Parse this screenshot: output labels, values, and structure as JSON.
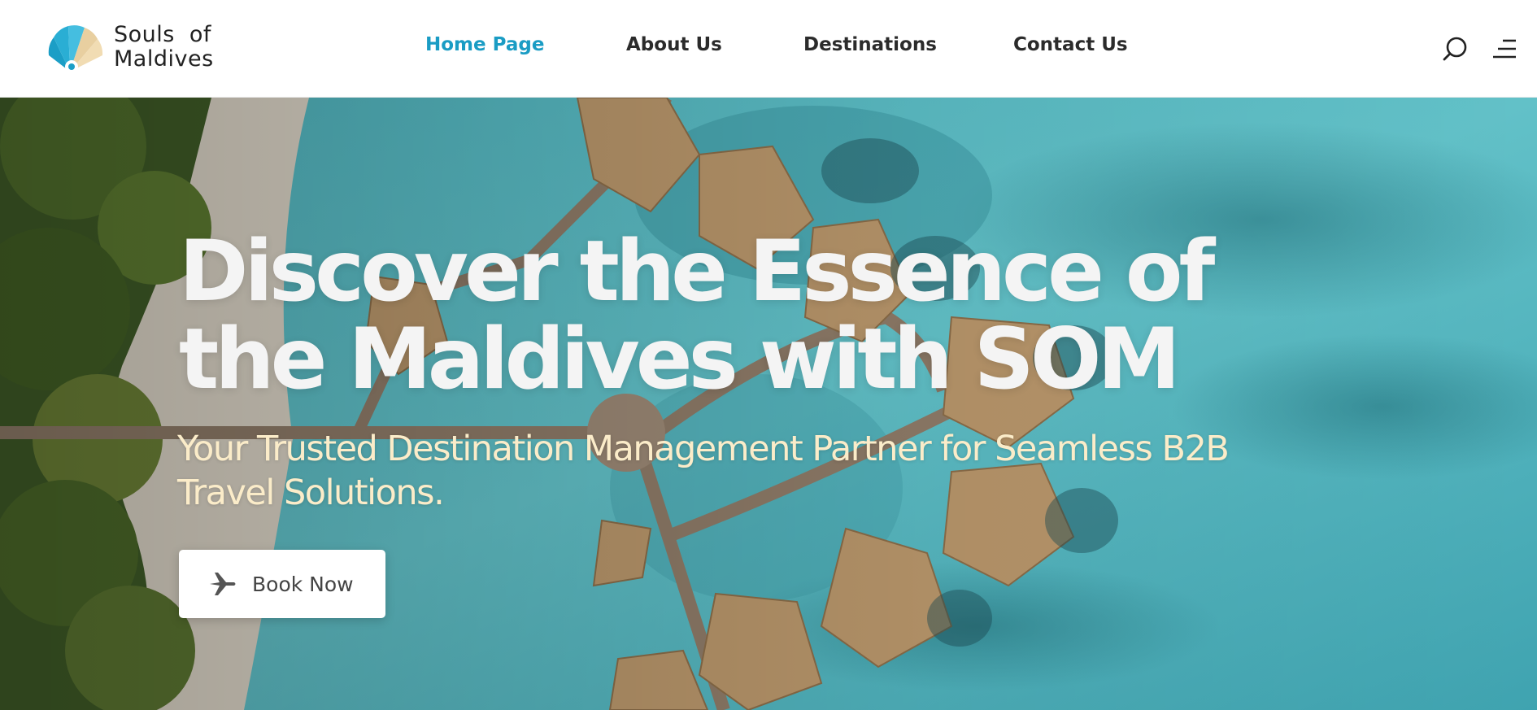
{
  "brand": {
    "name_line1_a": "Souls",
    "name_line1_b": "of",
    "name_line2": "Maldives"
  },
  "nav": [
    {
      "label": "Home Page",
      "active": true
    },
    {
      "label": "About Us",
      "active": false
    },
    {
      "label": "Destinations",
      "active": false
    },
    {
      "label": "Contact Us",
      "active": false
    }
  ],
  "header_icons": [
    "search-icon",
    "menu-icon"
  ],
  "hero": {
    "title": "Discover the Essence of the Maldives with SOM",
    "subtitle": "Your Trusted Destination Management Partner for Seamless B2B Travel Solutions.",
    "button_label": "Book Now",
    "button_icon": "airplane-icon"
  },
  "colors": {
    "accent": "#1a9cc4",
    "subtitle": "#fbecc9",
    "water": "#5ab9c2"
  }
}
